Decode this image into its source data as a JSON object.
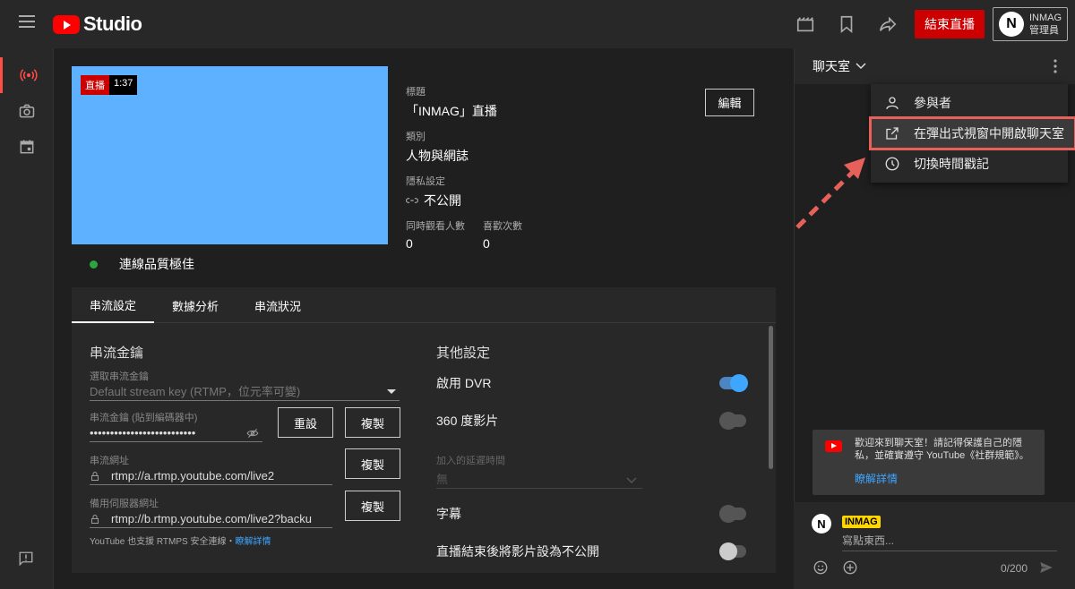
{
  "topbar": {
    "studio_label": "Studio",
    "end_live_label": "結束直播",
    "account_name": "INMAG",
    "account_role": "管理員",
    "avatar_letter": "N"
  },
  "preview": {
    "live_tag": "直播",
    "elapsed": "1:37",
    "quality_label": "連線品質極佳"
  },
  "info": {
    "title_label": "標題",
    "title_value": "「INMAG」直播",
    "category_label": "類別",
    "category_value": "人物與網誌",
    "privacy_label": "隱私設定",
    "privacy_value": "不公開",
    "concurrent_label": "同時觀看人數",
    "concurrent_value": "0",
    "likes_label": "喜歡次數",
    "likes_value": "0",
    "edit_label": "編輯"
  },
  "tabs": [
    "串流設定",
    "數據分析",
    "串流狀況"
  ],
  "stream_settings": {
    "section_title": "串流金鑰",
    "select_key_label": "選取串流金鑰",
    "select_key_value": "Default stream key (RTMP，位元率可變)",
    "key_label": "串流金鑰 (貼到編碼器中)",
    "key_value": "••••••••••••••••••••••••••",
    "reset_label": "重設",
    "copy_label": "複製",
    "url_label": "串流網址",
    "url_value": "rtmp://a.rtmp.youtube.com/live2",
    "backup_label": "備用伺服器網址",
    "backup_value": "rtmp://b.rtmp.youtube.com/live2?backu",
    "rtmps_note": "YouTube 也支援 RTMPS 安全連線・",
    "rtmps_link": "瞭解詳情"
  },
  "other_settings": {
    "section_title": "其他設定",
    "dvr_label": "啟用 DVR",
    "dvr_on": true,
    "vr_label": "360 度影片",
    "vr_on": false,
    "delay_label": "加入的延遲時間",
    "delay_value": "無",
    "captions_label": "字幕",
    "captions_on": false,
    "unlist_label": "直播結束後將影片設為不公開",
    "unlist_on": false
  },
  "chat": {
    "title": "聊天室",
    "menu": [
      {
        "label": "參與者",
        "icon": "person-icon"
      },
      {
        "label": "在彈出式視窗中開啟聊天室",
        "icon": "popout-icon"
      },
      {
        "label": "切換時間戳記",
        "icon": "clock-icon"
      }
    ],
    "welcome_text": "歡迎來到聊天室！請記得保護自己的隱私，並確實遵守 YouTube《社群規範》。",
    "welcome_link": "瞭解詳情",
    "user_name": "INMAG",
    "input_placeholder": "寫點東西...",
    "char_count": "0/200"
  },
  "colors": {
    "brand_red": "#ff0000",
    "end_button": "#cc0000",
    "preview_blue": "#5db1ff",
    "link_blue": "#3ea6ff",
    "highlight_outline": "#e8605a",
    "status_green": "#2ba640"
  }
}
